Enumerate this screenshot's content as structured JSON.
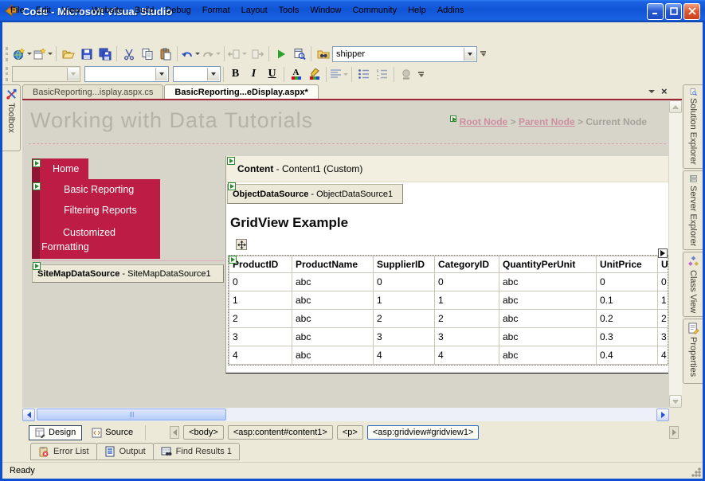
{
  "window": {
    "title": "Code - Microsoft Visual Studio"
  },
  "menu_bar": {
    "items": [
      "File",
      "Edit",
      "View",
      "Website",
      "Build",
      "Debug",
      "Format",
      "Layout",
      "Tools",
      "Window",
      "Community",
      "Help",
      "Addins"
    ]
  },
  "standard_toolbar": {
    "icons": [
      "new-website",
      "add-new-item",
      "open-file",
      "save",
      "save-all",
      "cut",
      "copy",
      "paste",
      "undo",
      "redo",
      "navigate-backward",
      "navigate-forward",
      "start-debugging",
      "view-in-browser",
      "find-in-files"
    ],
    "find_combo_value": "shipper"
  },
  "formatting_toolbar": {
    "icons": [
      "block-format-combo",
      "font-name-combo",
      "font-size-combo",
      "bold",
      "italic",
      "underline",
      "font-color",
      "highlight",
      "align-left",
      "bullets",
      "numbering",
      "hyperlink"
    ],
    "bold_label": "B",
    "italic_label": "I",
    "underline_label": "U",
    "font_color_label": "A"
  },
  "document_tabs": {
    "tabs": [
      {
        "label": "BasicReporting...isplay.aspx.cs"
      },
      {
        "label": "BasicReporting...eDisplay.aspx*"
      }
    ]
  },
  "left_tool_tabs": {
    "items": [
      {
        "label": "Toolbox"
      }
    ]
  },
  "right_tool_tabs": {
    "items": [
      {
        "label": "Solution Explorer"
      },
      {
        "label": "Server Explorer"
      },
      {
        "label": "Class View"
      },
      {
        "label": "Properties"
      }
    ]
  },
  "designer": {
    "page_title": "Working with Data Tutorials",
    "breadcrumb": {
      "items": [
        "Root Node",
        "Parent Node",
        "Current Node"
      ],
      "separator": ">"
    },
    "nav_menu": {
      "items": [
        "Home",
        "Basic Reporting",
        "Filtering Reports",
        "Customized Formatting"
      ]
    },
    "sitemap_datasource": {
      "type_name": "SiteMapDataSource",
      "suffix": " - SiteMapDataSource1"
    },
    "content_placeholder": {
      "type_name": "Content",
      "suffix": " - Content1 (Custom)"
    },
    "object_datasource": {
      "type_name": "ObjectDataSource",
      "suffix": " - ObjectDataSource1"
    },
    "gridview": {
      "heading": "GridView Example",
      "table": {
        "headers": [
          "ProductID",
          "ProductName",
          "SupplierID",
          "CategoryID",
          "QuantityPerUnit",
          "UnitPrice",
          "Uni"
        ],
        "rows": [
          [
            "0",
            "abc",
            "0",
            "0",
            "abc",
            "0",
            "0"
          ],
          [
            "1",
            "abc",
            "1",
            "1",
            "abc",
            "0.1",
            "1"
          ],
          [
            "2",
            "abc",
            "2",
            "2",
            "abc",
            "0.2",
            "2"
          ],
          [
            "3",
            "abc",
            "3",
            "3",
            "abc",
            "0.3",
            "3"
          ],
          [
            "4",
            "abc",
            "4",
            "4",
            "abc",
            "0.4",
            "4"
          ]
        ]
      }
    }
  },
  "view_switcher": {
    "design_label": "Design",
    "source_label": "Source"
  },
  "tag_navigator": {
    "tags": [
      "<body>",
      "<asp:content#content1>",
      "<p>",
      "<asp:gridview#gridview1>"
    ],
    "selected_index": 3
  },
  "bottom_panels": {
    "tabs": [
      "Error List",
      "Output",
      "Find Results 1"
    ]
  },
  "status_bar": {
    "text": "Ready"
  },
  "colors": {
    "xp_blue": "#0b50d0",
    "menu_red": "#bd1c45",
    "menu_dark_red": "#8e1534",
    "tab_underline": "#9c2437",
    "breadcrumb_link": "#cc8fa0",
    "page_title_gray": "#b5b2a8",
    "selection_blue": "#316ac5"
  }
}
